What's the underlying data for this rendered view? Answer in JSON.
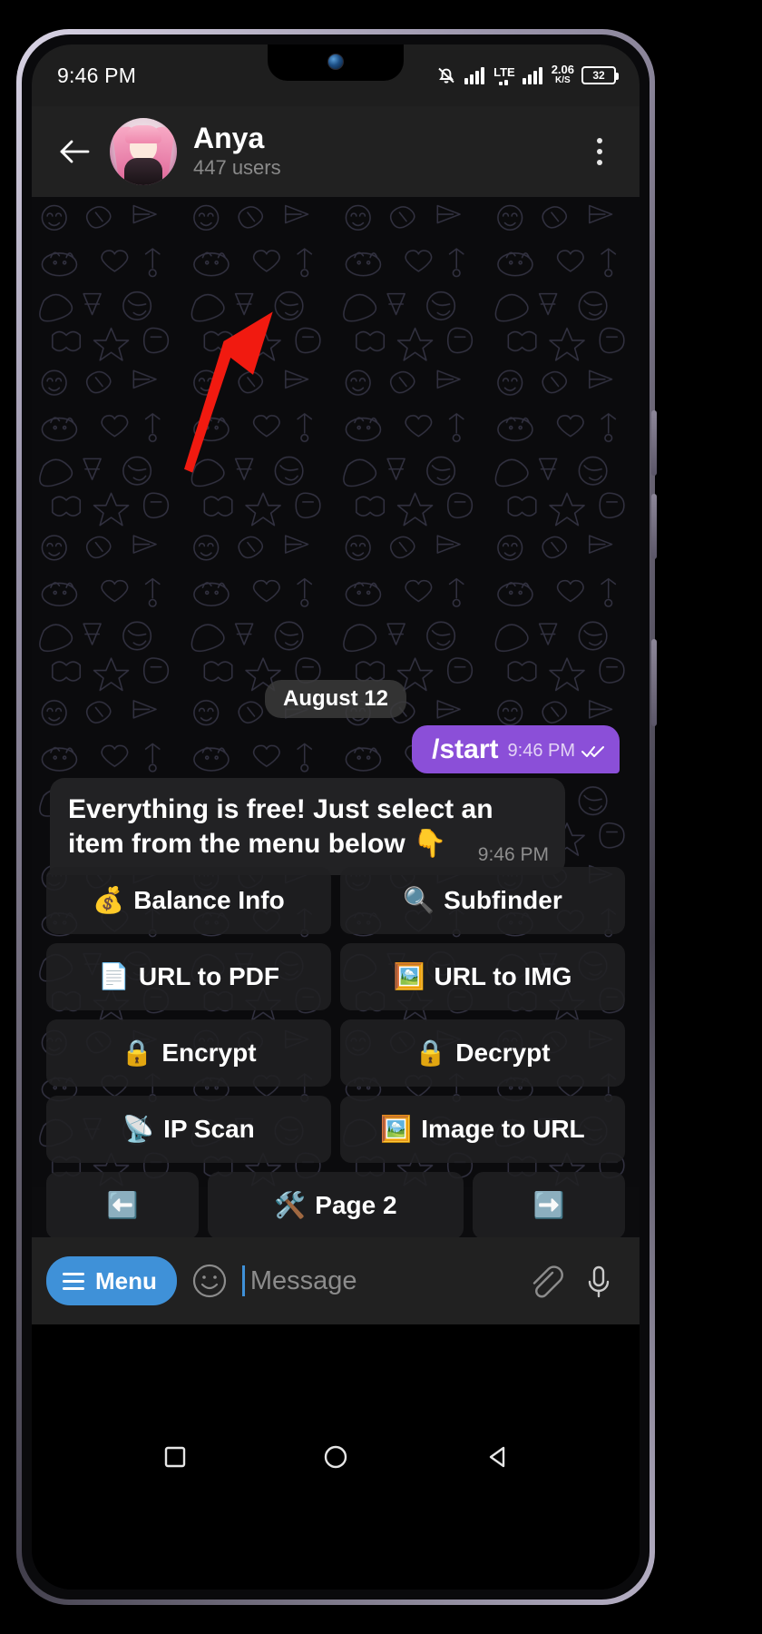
{
  "status_bar": {
    "time": "9:46 PM",
    "icons": [
      "bell-mute-icon",
      "signal-bars-icon",
      "lte-label",
      "signal-bars-2-icon"
    ],
    "lte_label": "LTE",
    "net_speed_value": "2.06",
    "net_speed_unit": "K/S",
    "battery_level": "32"
  },
  "header": {
    "back_icon": "back-arrow-icon",
    "avatar": "anya-avatar",
    "title": "Anya",
    "subtitle": "447 users",
    "overflow_icon": "more-vertical-icon"
  },
  "chat": {
    "date_separator": "August 12",
    "outgoing": {
      "text": "/start",
      "time": "9:46 PM",
      "status_icon": "double-check-icon"
    },
    "incoming": {
      "text": "Everything is free! Just select an item from the menu below 👇",
      "time": "9:46 PM"
    }
  },
  "keyboard": {
    "rows": [
      [
        {
          "emoji": "💰",
          "label": "Balance Info",
          "name": "balance-info"
        },
        {
          "emoji": "🔍",
          "label": "Subfinder",
          "name": "subfinder"
        }
      ],
      [
        {
          "emoji": "📄",
          "label": "URL to PDF",
          "name": "url-to-pdf"
        },
        {
          "emoji": "🖼️",
          "label": "URL to IMG",
          "name": "url-to-img"
        }
      ],
      [
        {
          "emoji": "🔒",
          "label": "Encrypt",
          "name": "encrypt"
        },
        {
          "emoji": "🔒",
          "label": "Decrypt",
          "name": "decrypt"
        }
      ],
      [
        {
          "emoji": "📡",
          "label": "IP Scan",
          "name": "ip-scan"
        },
        {
          "emoji": "🖼️",
          "label": "Image to URL",
          "name": "image-to-url"
        }
      ]
    ],
    "nav_row": {
      "prev": {
        "emoji": "⬅️",
        "label": "",
        "name": "prev-page"
      },
      "page": {
        "emoji": "🛠️",
        "label": "Page 2",
        "name": "page-indicator"
      },
      "next": {
        "emoji": "➡️",
        "label": "",
        "name": "next-page"
      }
    }
  },
  "input_bar": {
    "menu_label": "Menu",
    "emoji_icon": "smiley-icon",
    "placeholder": "Message",
    "attach_icon": "paperclip-icon",
    "mic_icon": "microphone-icon"
  },
  "nav_bar": {
    "recents_icon": "square-icon",
    "home_icon": "circle-icon",
    "back_icon": "triangle-back-icon"
  },
  "annotation": {
    "arrow_color": "#f11a10",
    "points_to": "balance-info"
  },
  "colors": {
    "accent_purple": "#8b4fd8",
    "accent_blue": "#3f91d8",
    "header_bg": "#212121",
    "bubble_in": "#222224"
  }
}
